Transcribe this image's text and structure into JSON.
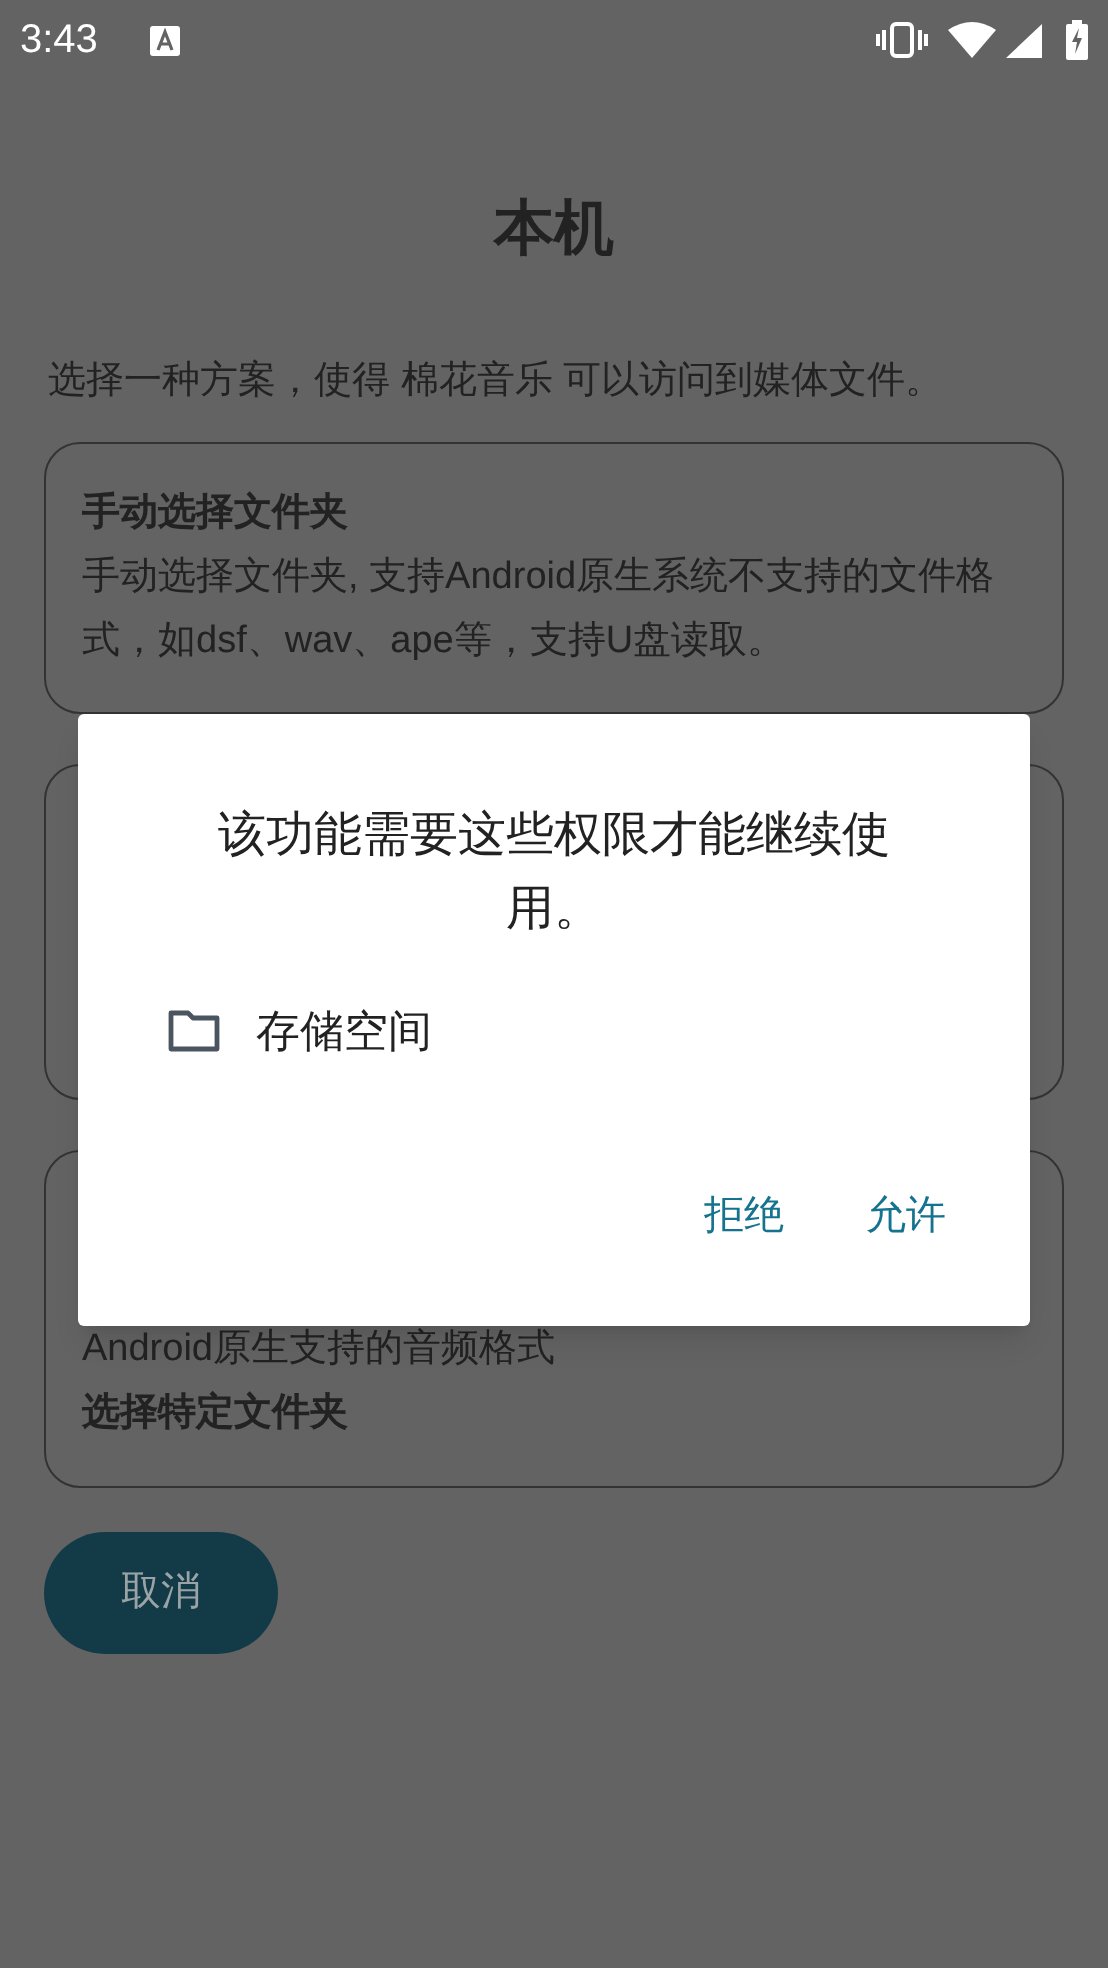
{
  "status_bar": {
    "time": "3:43"
  },
  "title": "本机",
  "subtitle": "选择一种方案，使得 棉花音乐 可以访问到媒体文件。",
  "options": [
    {
      "title": "手动选择文件夹",
      "lines": [
        "手动选择文件夹, 支持Android原生系统不支持的文件格式，如dsf、wav、ape等，支持U盘读取。"
      ]
    },
    {
      "lines": [
        "Android原生支持的音频格式"
      ],
      "footer": "选择特定文件夹"
    }
  ],
  "cancel_button": "取消",
  "dialog": {
    "message": "该功能需要这些权限才能继续使用。",
    "permission": "存储空间",
    "buttons": [
      "拒绝",
      "允许"
    ]
  }
}
